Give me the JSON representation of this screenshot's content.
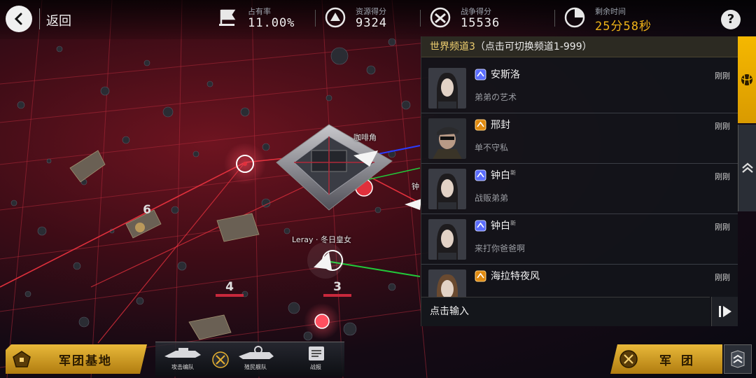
{
  "topbar": {
    "back_label": "返回",
    "stats": [
      {
        "label": "占有率",
        "value": "11.00%",
        "icon": "flag-icon"
      },
      {
        "label": "资源得分",
        "value": "9324",
        "icon": "resource-icon"
      },
      {
        "label": "战争得分",
        "value": "15536",
        "icon": "war-icon"
      },
      {
        "label": "剩余时间",
        "value": "25分58秒",
        "icon": "clock-icon",
        "highlight": "#f0b418"
      }
    ],
    "help_label": "?"
  },
  "map": {
    "fleet_labels": [
      "咖啡角",
      "Leray · 冬日皇女",
      "钟"
    ],
    "sectors": [
      "6",
      "4",
      "3"
    ]
  },
  "chat": {
    "channel": "世界频道3",
    "channel_hint": "（点击可切换频道1-999）",
    "messages": [
      {
        "name": "安斯洛",
        "time": "刚刚",
        "text": "弟弟の艺术",
        "rank_color": "#5a6cff"
      },
      {
        "name": "邢封",
        "time": "刚刚",
        "text": "单不守私",
        "rank_color": "#e08a10"
      },
      {
        "name": "钟白",
        "name_sup": "新",
        "time": "刚刚",
        "text": "战贩弟弟",
        "rank_color": "#5a6cff"
      },
      {
        "name": "钟白",
        "name_sup": "新",
        "time": "刚刚",
        "text": "来打你爸爸啊",
        "rank_color": "#5a6cff"
      },
      {
        "name": "海拉特夜风",
        "time": "刚刚",
        "text": "",
        "rank_color": "#e08a10"
      }
    ],
    "input_placeholder": "点击输入"
  },
  "bottom": {
    "base_label": "军团基地",
    "fleet_slots": [
      {
        "caption": "攻击编队"
      },
      {
        "caption": "殖民舰队"
      },
      {
        "caption": "战报"
      }
    ],
    "legion_label": "军团"
  },
  "colors": {
    "accent": "#f0b418",
    "gold_button": "#e9b93a",
    "red_route": "#e0303c",
    "green_route": "#22c93a",
    "blue_route": "#2a3cff"
  }
}
